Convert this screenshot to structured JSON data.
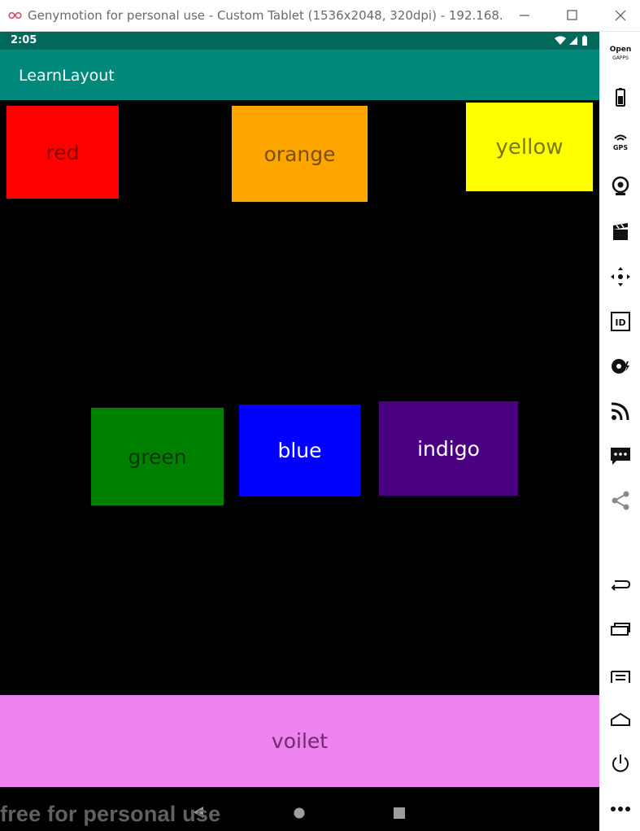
{
  "window": {
    "title": "Genymotion for personal use - Custom Tablet (1536x2048, 320dpi) - 192.168....",
    "controls": [
      "minimize-icon",
      "maximize-icon",
      "close-icon"
    ]
  },
  "status_bar": {
    "time": "2:05",
    "icons": [
      "wifi-icon",
      "signal-icon",
      "battery-icon"
    ]
  },
  "app_bar": {
    "title": "LearnLayout",
    "color": "#00897b",
    "status_color": "#00695c"
  },
  "boxes": [
    {
      "id": "red",
      "label": "red",
      "bg": "#ff0000",
      "fg": "#8b0000"
    },
    {
      "id": "orange",
      "label": "orange",
      "bg": "#ffa500",
      "fg": "#7a4f00"
    },
    {
      "id": "yellow",
      "label": "yellow",
      "bg": "#ffff00",
      "fg": "#7a7a00"
    },
    {
      "id": "green",
      "label": "green",
      "bg": "#008000",
      "fg": "#003a00"
    },
    {
      "id": "blue",
      "label": "blue",
      "bg": "#0000ff",
      "fg": "#ffffff"
    },
    {
      "id": "indigo",
      "label": "indigo",
      "bg": "#4b0082",
      "fg": "#ffffff"
    },
    {
      "id": "voilet",
      "label": "voilet",
      "bg": "#ee82ee",
      "fg": "#6b2d6b"
    }
  ],
  "nav_bar": {
    "buttons": [
      "back-icon",
      "home-icon",
      "recents-icon"
    ]
  },
  "watermark": "free for personal use",
  "sidebar": {
    "open_gapps_line1": "Open",
    "open_gapps_line2": "GAPPS",
    "gps_label": "GPS",
    "id_label": "ID",
    "icons": [
      "battery-widget-icon",
      "gps-widget-icon",
      "webcam-icon",
      "capture-icon",
      "navigation-icon",
      "identifiers-icon",
      "disk-io-icon",
      "network-icon",
      "sms-icon",
      "share-icon",
      "back-icon",
      "recent-apps-icon",
      "menu-icon",
      "home-icon",
      "power-icon",
      "more-icon"
    ]
  }
}
